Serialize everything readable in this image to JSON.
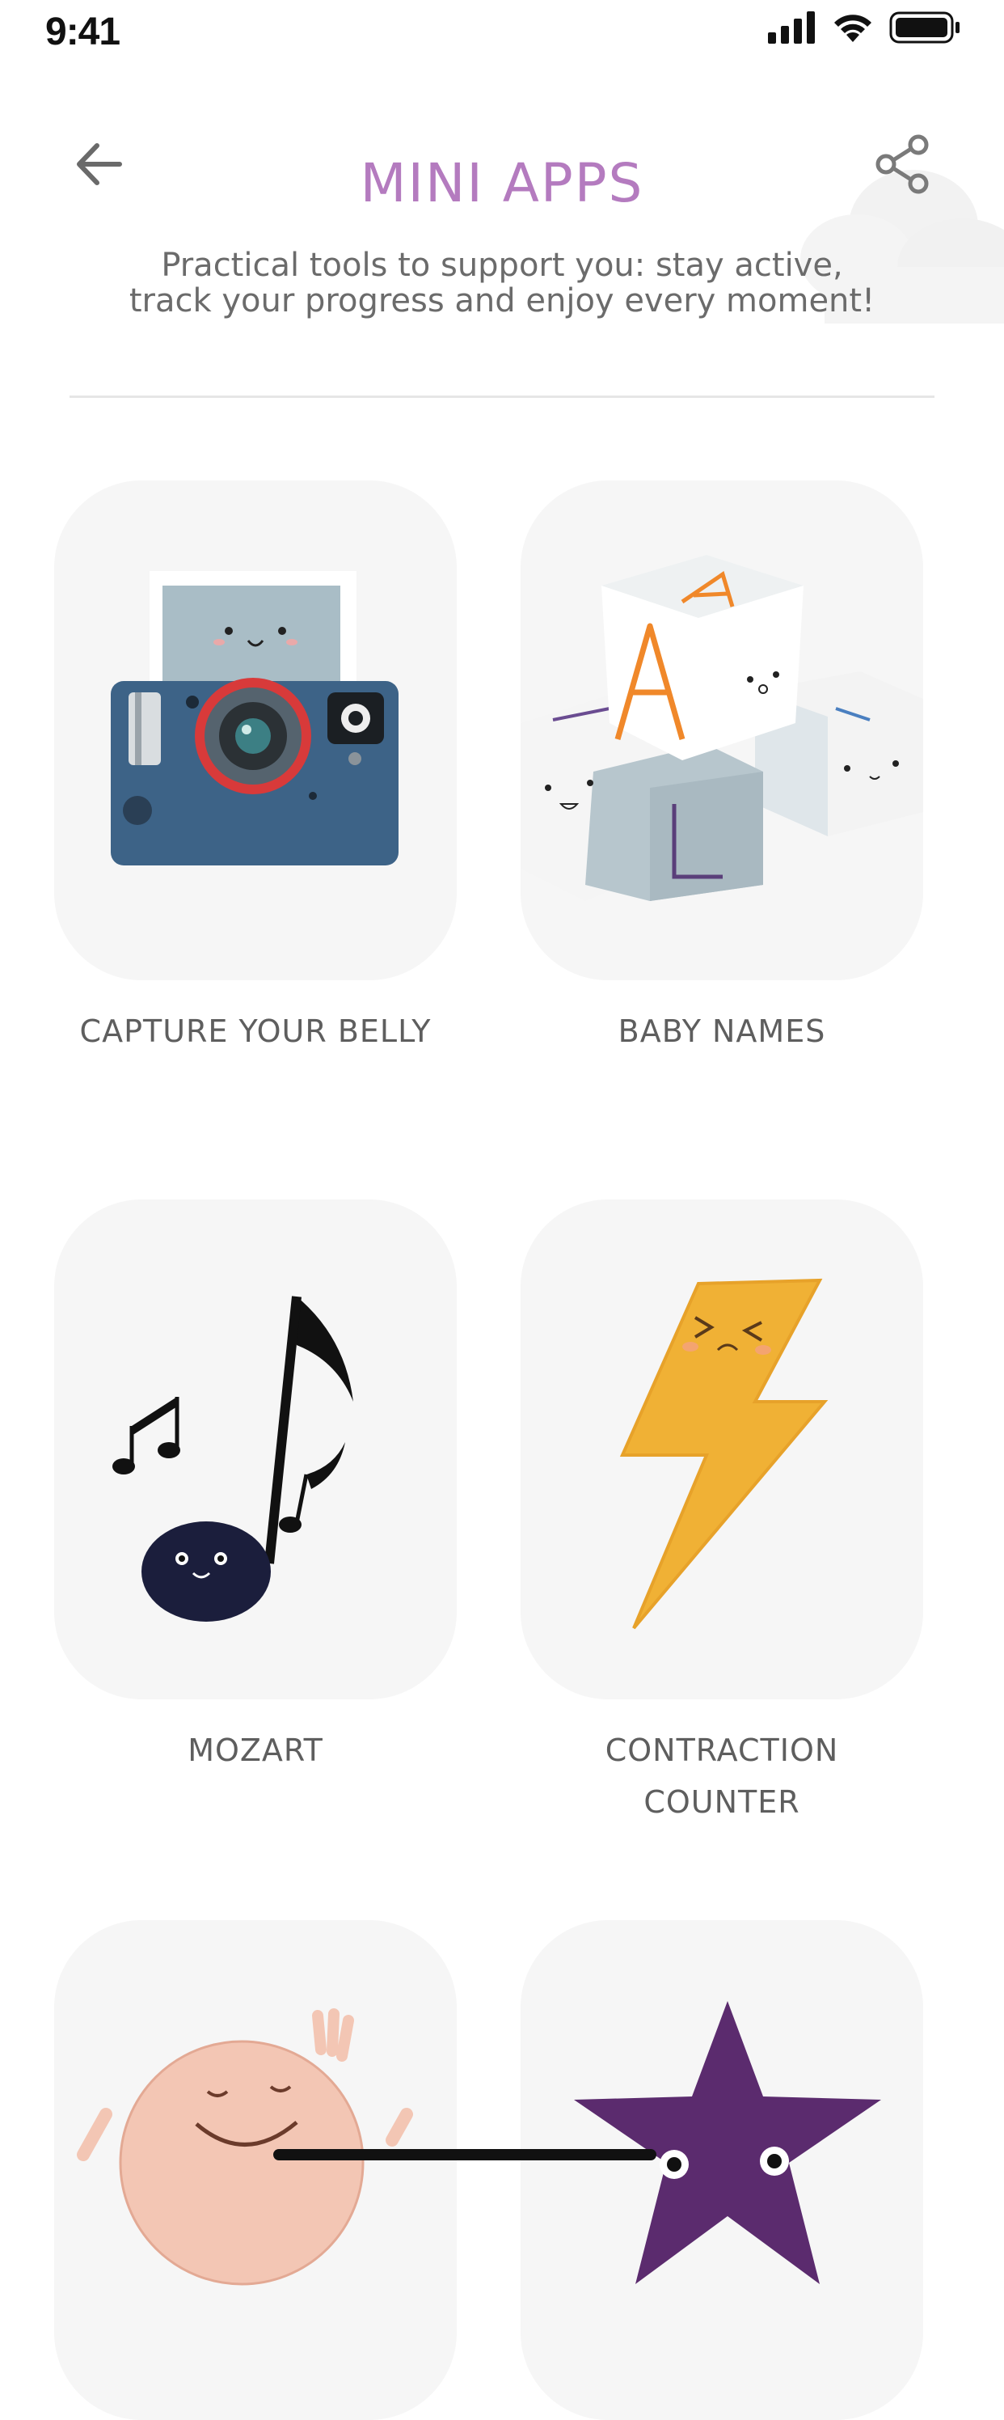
{
  "status_bar": {
    "time": "9:41"
  },
  "header": {
    "title": "MINI APPS",
    "subtitle_line1": "Practical tools to support you: stay active,",
    "subtitle_line2": "track your progress and enjoy every moment!"
  },
  "apps": [
    {
      "label": "CAPTURE YOUR BELLY",
      "icon": "camera-icon"
    },
    {
      "label": "BABY NAMES",
      "icon": "alphabet-blocks-icon"
    },
    {
      "label": "MOZART",
      "icon": "music-notes-icon"
    },
    {
      "label_line1": "CONTRACTION",
      "label_line2": "COUNTER",
      "icon": "lightning-bolt-icon"
    },
    {
      "label": "",
      "icon": "baby-icon"
    },
    {
      "label": "",
      "icon": "star-icon"
    }
  ],
  "colors": {
    "title": "#b47bbf",
    "card_bg": "#f6f6f6",
    "text": "#5e5e5e"
  }
}
